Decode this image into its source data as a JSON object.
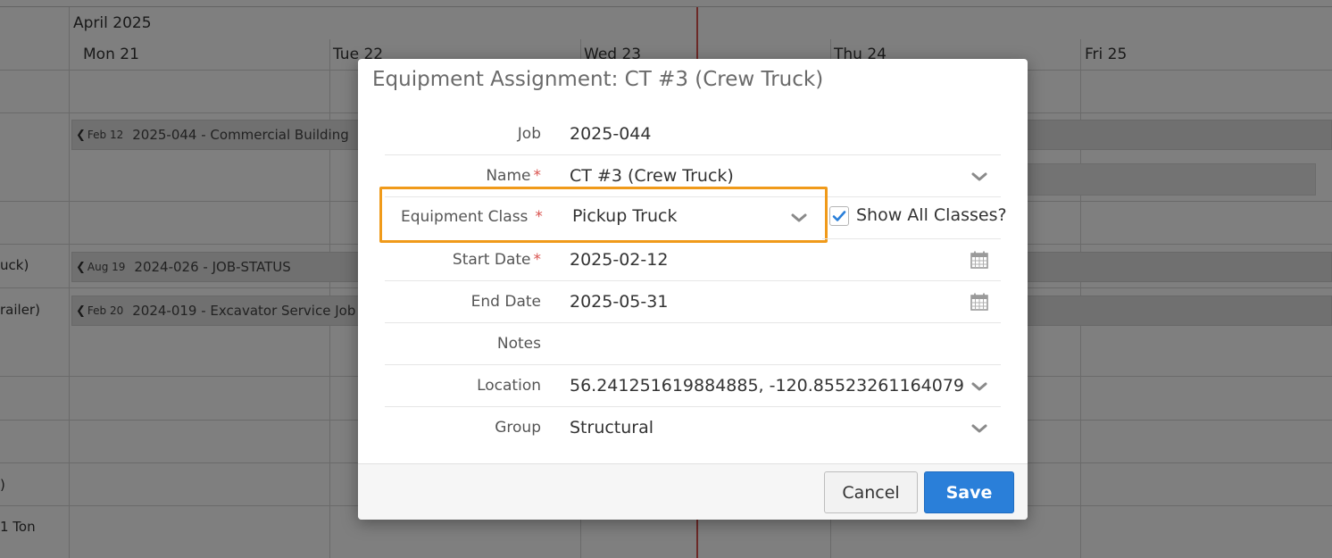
{
  "calendar": {
    "month": "April 2025",
    "days": [
      "Mon 21",
      "Tue 22",
      "Wed 23",
      "Thu 24",
      "Fri 25"
    ],
    "resource_labels": [
      "uck)",
      "railer)",
      ")",
      "1 Ton"
    ],
    "events": [
      {
        "start": "Feb 12",
        "title": "2025-044 - Commercial Building"
      },
      {
        "start": "Aug 19",
        "title": "2024-026 - JOB-STATUS"
      },
      {
        "start": "Feb 20",
        "title": "2024-019 - Excavator Service Job"
      }
    ]
  },
  "modal": {
    "title": "Equipment Assignment: CT #3 (Crew Truck)",
    "fields": {
      "job": {
        "label": "Job",
        "value": "2025-044"
      },
      "name": {
        "label": "Name",
        "value": "CT #3 (Crew Truck)",
        "required": "*"
      },
      "equipment_class": {
        "label": "Equipment Class",
        "value": "Pickup Truck",
        "required": "*"
      },
      "start_date": {
        "label": "Start Date",
        "value": "2025-02-12",
        "required": "*"
      },
      "end_date": {
        "label": "End Date",
        "value": "2025-05-31"
      },
      "notes": {
        "label": "Notes",
        "value": ""
      },
      "location": {
        "label": "Location",
        "value": "56.241251619884885, -120.85523261164079"
      },
      "group": {
        "label": "Group",
        "value": "Structural"
      }
    },
    "show_all_classes": {
      "label": "Show All Classes?",
      "checked": true
    },
    "buttons": {
      "cancel": "Cancel",
      "save": "Save"
    }
  },
  "colors": {
    "highlight": "#f09a1a",
    "required": "#d9534f",
    "save_button": "#2a7fd9",
    "checkbox_check": "#2a7fd9"
  }
}
